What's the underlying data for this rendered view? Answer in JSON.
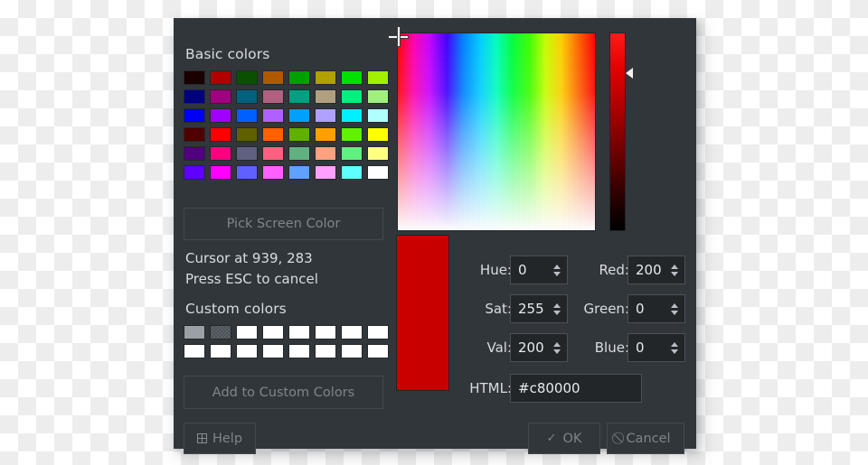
{
  "dialog": {
    "basic_colors_title": "Basic colors",
    "custom_colors_title": "Custom colors",
    "pick_screen_color_label": "Pick Screen Color",
    "add_to_custom_colors_label": "Add to Custom Colors",
    "help_label": "Help",
    "ok_label": "OK",
    "cancel_label": "Cancel",
    "help_icon": "missing-glyph-box-icon",
    "ok_icon": "check-icon",
    "cancel_icon": "no-entry-icon",
    "ok_glyph": "✓",
    "cancel_glyph": "⃠",
    "background": "#31363b"
  },
  "status": {
    "cursor_line": "Cursor at 939, 283",
    "hint_line": "Press ESC to cancel"
  },
  "basic_colors": [
    [
      "#1a0000",
      "#b00000",
      "#0a5000",
      "#b05a00",
      "#00a000",
      "#b0a000",
      "#00e000",
      "#a0f000"
    ],
    [
      "#000080",
      "#a00080",
      "#00607f",
      "#b06080",
      "#00a080",
      "#b0a080",
      "#00f080",
      "#a0f080"
    ],
    [
      "#0000f5",
      "#a000ff",
      "#0060ff",
      "#b060ff",
      "#00a0ff",
      "#b0a0ff",
      "#00f0ff",
      "#b0ffff"
    ],
    [
      "#500000",
      "#ff0000",
      "#606000",
      "#ff6000",
      "#60b000",
      "#ffa000",
      "#60f000",
      "#ffff00"
    ],
    [
      "#500080",
      "#ff0080",
      "#606080",
      "#ff6080",
      "#60b080",
      "#ffa080",
      "#60f080",
      "#ffff80"
    ],
    [
      "#6000ff",
      "#ff00ff",
      "#6060ff",
      "#ff60ff",
      "#60a0ff",
      "#ffa0ff",
      "#60ffff",
      "#ffffff"
    ]
  ],
  "custom_colors": [
    [
      "#9aa0a6",
      "speckle",
      "#ffffff",
      "#ffffff",
      "#ffffff",
      "#ffffff",
      "#ffffff",
      "#ffffff"
    ],
    [
      "#ffffff",
      "#ffffff",
      "#ffffff",
      "#ffffff",
      "#ffffff",
      "#ffffff",
      "#ffffff",
      "#ffffff"
    ]
  ],
  "preview": {
    "color": "#c80000"
  },
  "fields": {
    "hue_label": "Hue:",
    "hue_value": "0",
    "sat_label": "Sat:",
    "sat_value": "255",
    "val_label": "Val:",
    "val_value": "200",
    "red_label": "Red:",
    "red_value": "200",
    "green_label": "Green:",
    "green_value": "0",
    "blue_label": "Blue:",
    "blue_value": "0",
    "html_label": "HTML:",
    "html_value": "#c80000"
  }
}
